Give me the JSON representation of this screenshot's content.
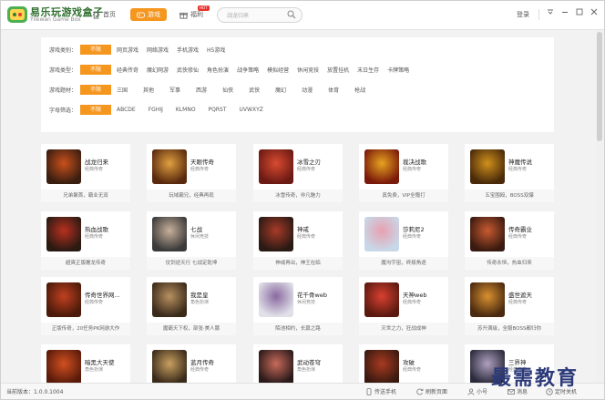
{
  "header": {
    "app_title": "易乐玩游戏盒子",
    "app_subtitle": "Yilewan Game Box",
    "nav": [
      {
        "label": "首页",
        "icon": "home-icon"
      },
      {
        "label": "游戏",
        "icon": "gamepad-icon",
        "active": true
      },
      {
        "label": "福利",
        "icon": "gift-icon",
        "badge": "HOT"
      }
    ],
    "search_placeholder": "战龙归来",
    "login_label": "登录"
  },
  "filters": {
    "rows": [
      {
        "label": "游戏类别：",
        "selected": "不限",
        "options": [
          "网页游戏",
          "网络游戏",
          "手机游戏",
          "H5游戏"
        ]
      },
      {
        "label": "游戏类型：",
        "selected": "不限",
        "options": [
          "经典传奇",
          "魔幻网游",
          "武侠修仙",
          "角色扮演",
          "战争策略",
          "模拟经营",
          "休闲竞技",
          "放置挂机",
          "末日生存",
          "卡牌策略"
        ]
      },
      {
        "label": "游戏题材：",
        "selected": "不限",
        "options": [
          "三国",
          "其他",
          "军事",
          "西游",
          "仙侠",
          "武侠",
          "魔幻",
          "动漫",
          "体育",
          "枪战"
        ]
      },
      {
        "label": "字母筛选：",
        "selected": "不限",
        "options": [
          "ABCDE",
          "FGHIJ",
          "KLMNO",
          "PQRST",
          "UVWXYZ"
        ]
      }
    ]
  },
  "games": [
    {
      "name": "战龙归来",
      "tag": "经典传奇",
      "desc": "兄弟聚首，霸业无双",
      "colors": [
        "#3a1e10",
        "#c9501c"
      ]
    },
    {
      "name": "天眼传奇",
      "tag": "经典传奇",
      "desc": "玩域霸兄，经典再现",
      "colors": [
        "#5a2a0e",
        "#e0a040"
      ]
    },
    {
      "name": "冰雪之刃",
      "tag": "经典传奇",
      "desc": "冰雪传奇，非凡魅力",
      "colors": [
        "#6b1a14",
        "#d84a30"
      ]
    },
    {
      "name": "裁决战歌",
      "tag": "经典传奇",
      "desc": "真免费，VIP全赠打",
      "colors": [
        "#7a1a0a",
        "#e8a320"
      ]
    },
    {
      "name": "神魔传说",
      "tag": "经典传奇",
      "desc": "五宝围殴，BOSS双爆",
      "colors": [
        "#4a2a0a",
        "#d0901c"
      ]
    },
    {
      "name": "热血战歌",
      "tag": "经典传奇",
      "desc": "超爽正版屠龙传奇",
      "colors": [
        "#2a1a12",
        "#b83020"
      ]
    },
    {
      "name": "七战",
      "tag": "休闲竞技",
      "desc": "仗剑逆天行 七战定乾坤",
      "colors": [
        "#3a3a3a",
        "#c8b09a"
      ]
    },
    {
      "name": "神戒",
      "tag": "经典传奇",
      "desc": "神戒再出，神王在临",
      "colors": [
        "#2a1a14",
        "#a83a28"
      ]
    },
    {
      "name": "莎莉尼2",
      "tag": "经典传奇",
      "desc": "魔沟宇宙，终极角逐",
      "colors": [
        "#c8d8e8",
        "#e8a0b0"
      ]
    },
    {
      "name": "传奇霸业",
      "tag": "经典传奇",
      "desc": "传奇永恒，热血归来",
      "colors": [
        "#3a1a10",
        "#c85a30"
      ]
    },
    {
      "name": "传奇世界网...",
      "tag": "经典传奇",
      "desc": "正版传奇，20任务PK网游大作",
      "colors": [
        "#4a1a0a",
        "#c04020"
      ]
    },
    {
      "name": "我是皇",
      "tag": "角色扮演",
      "desc": "魔霸天下权，部张·美人膝",
      "colors": [
        "#3a2a1a",
        "#b89060"
      ]
    },
    {
      "name": "花千骨web",
      "tag": "休闲竞技",
      "desc": "陌池相约，长篇之路",
      "colors": [
        "#e0e0e8",
        "#8a6aa0"
      ]
    },
    {
      "name": "天神web",
      "tag": "经典传奇",
      "desc": "灭世之力，狂战成神",
      "colors": [
        "#5a1a10",
        "#d84030"
      ]
    },
    {
      "name": "盛世遮天",
      "tag": "经典传奇",
      "desc": "苏升满级，全服BOSS都归你",
      "colors": [
        "#4a2a10",
        "#d89030"
      ]
    },
    {
      "name": "暗黑大天使",
      "tag": "角色扮演",
      "desc": "",
      "colors": [
        "#5a1a0a",
        "#d05020"
      ]
    },
    {
      "name": "蓝月传奇",
      "tag": "经典传奇",
      "desc": "",
      "colors": [
        "#3a2a1a",
        "#c8a060"
      ]
    },
    {
      "name": "武动苍穹",
      "tag": "角色扮演",
      "desc": "",
      "colors": [
        "#2a1a1a",
        "#c86a5a"
      ]
    },
    {
      "name": "攻破",
      "tag": "经典传奇",
      "desc": "",
      "colors": [
        "#3a1a10",
        "#a83a20"
      ]
    },
    {
      "name": "三界神",
      "tag": "经典传奇",
      "desc": "",
      "colors": [
        "#2a2a3a",
        "#b0a0c0"
      ]
    }
  ],
  "statusbar": {
    "version": "当前版本：1.0.0.1004",
    "items": [
      {
        "label": "传送手机",
        "icon": "phone-icon"
      },
      {
        "label": "刷新页面",
        "icon": "refresh-icon"
      },
      {
        "label": "小号",
        "icon": "user-icon"
      },
      {
        "label": "消息",
        "icon": "mail-icon"
      },
      {
        "label": "定时关机",
        "icon": "clock-icon"
      }
    ]
  },
  "watermark": "最需教育"
}
